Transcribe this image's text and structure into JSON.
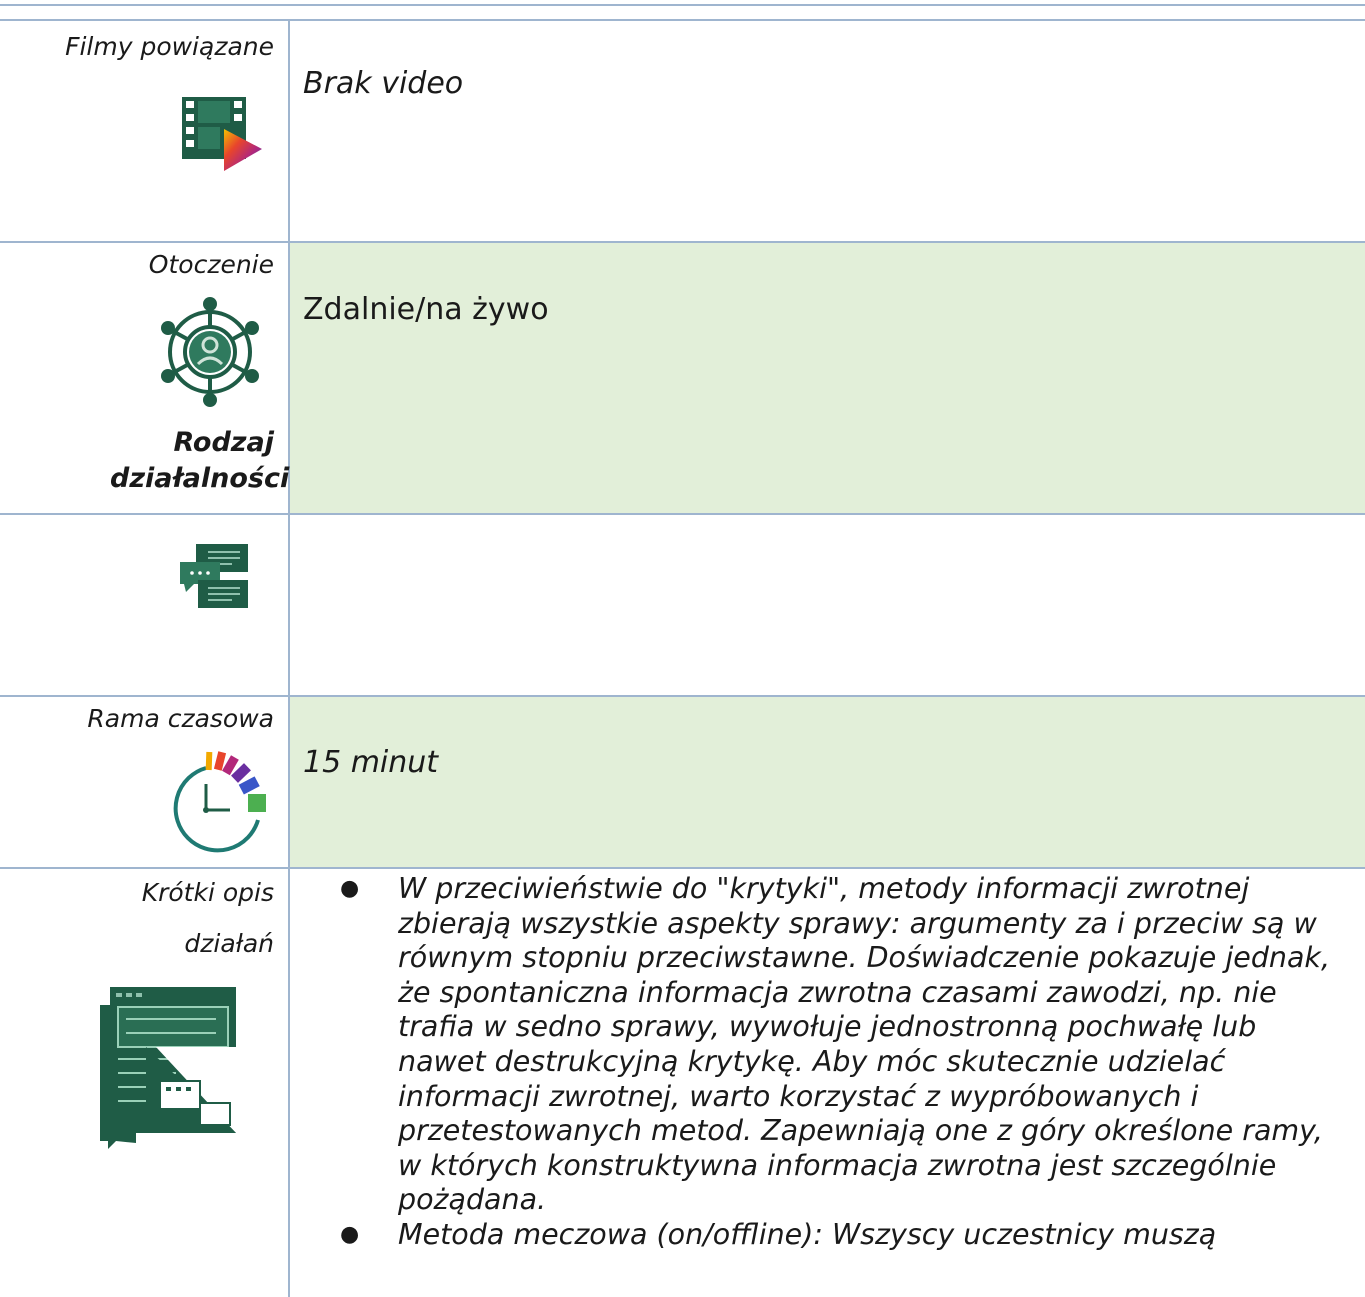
{
  "rows": {
    "videos": {
      "label": "Filmy powiązane",
      "value": "Brak video",
      "icon": "film-play-icon"
    },
    "environment": {
      "label": "Otoczenie",
      "value": "Zdalnie/na żywo",
      "icon": "network-person-icon"
    },
    "activity_type": {
      "label": "Rodzaj działalności",
      "value": "",
      "icon": "chat-bubbles-icon"
    },
    "timeframe": {
      "label": "Rama czasowa",
      "value": "15 minut",
      "icon": "clock-icon"
    },
    "description": {
      "label_line1": "Krótki opis",
      "label_line2": "działań",
      "icon": "document-chat-icon",
      "bullets": [
        "W przeciwieństwie do \"krytyki\", metody informacji zwrotnej zbierają wszystkie aspekty sprawy: argumenty za i przeciw są w równym stopniu przeciwstawne. Doświadczenie pokazuje jednak, że spontaniczna informacja zwrotna czasami zawodzi, np. nie trafia w sedno sprawy, wywołuje jednostronną pochwałę lub nawet destrukcyjną krytykę. Aby móc skutecznie udzielać informacji zwrotnej, warto korzystać z wypróbowanych i przetestowanych metod. Zapewniają one z góry określone ramy, w których konstruktywna informacja zwrotna jest szczególnie pożądana.",
        "Metoda meczowa (on/offline): Wszyscy uczestnicy muszą"
      ]
    }
  },
  "colors": {
    "border": "#9fb5cf",
    "green_fill": "#e2efd9",
    "icon_dark": "#1f5c46"
  }
}
